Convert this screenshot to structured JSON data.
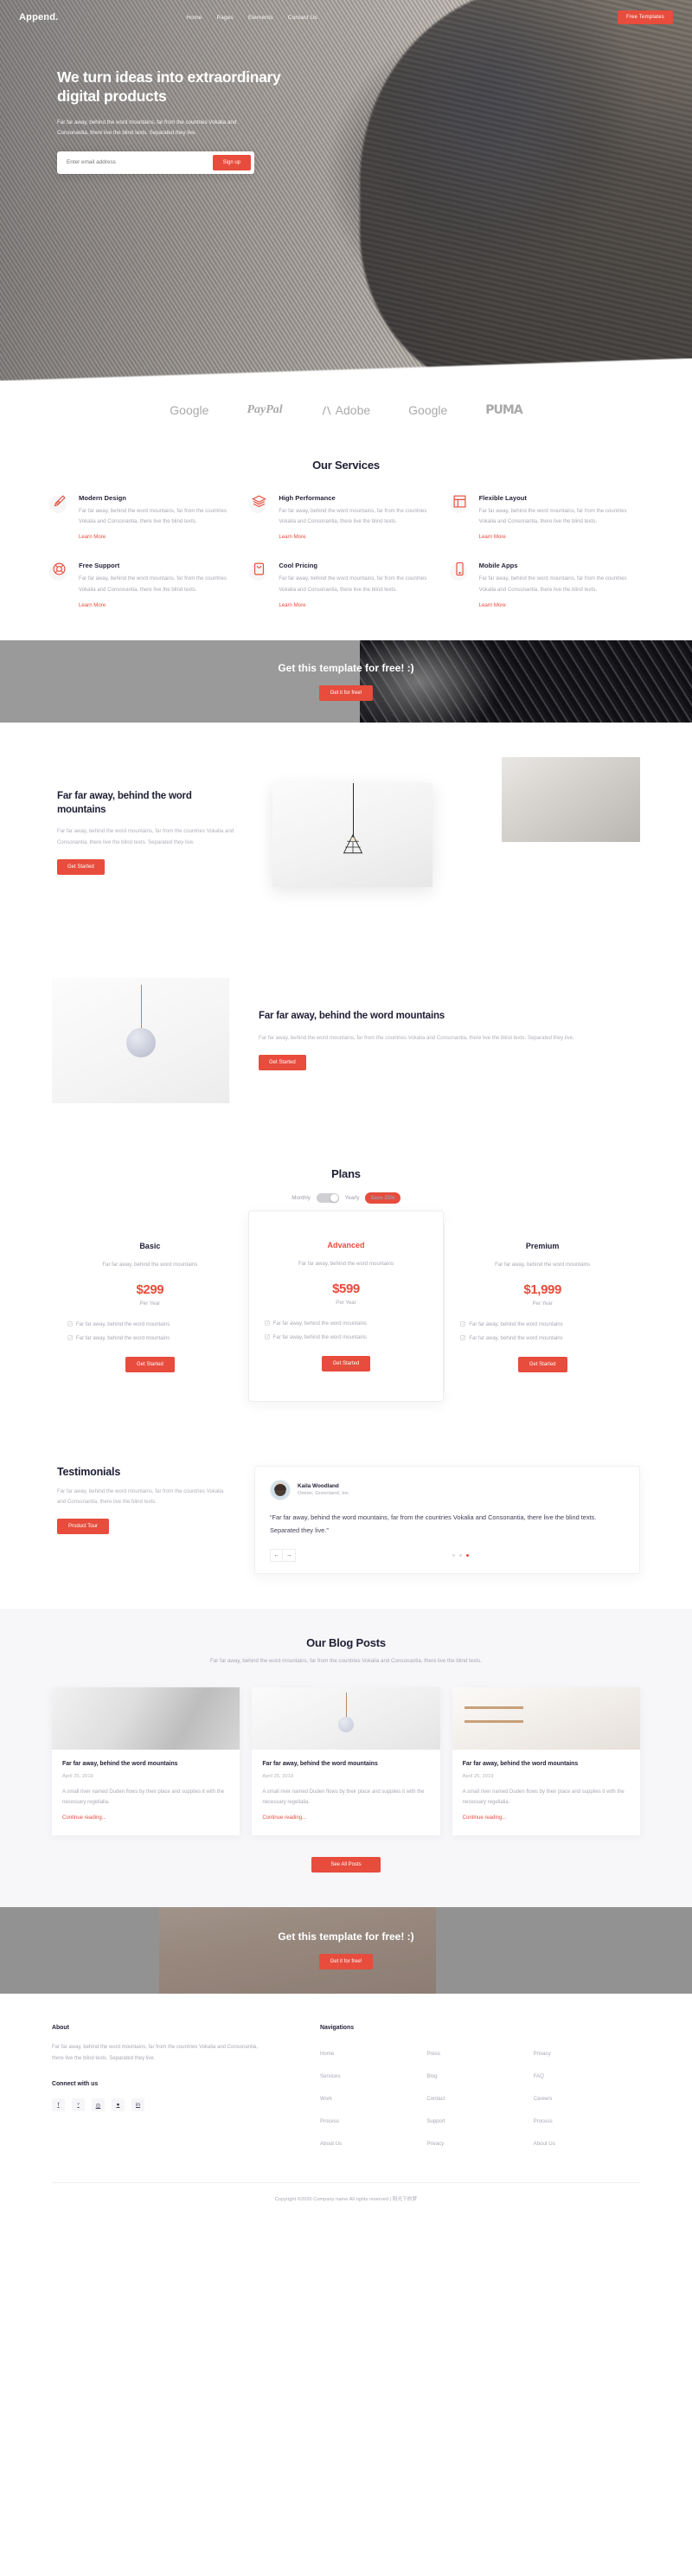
{
  "header": {
    "logo": "Append.",
    "nav": [
      {
        "label": "Home"
      },
      {
        "label": "Pages"
      },
      {
        "label": "Elements"
      },
      {
        "label": "Contact Us"
      }
    ],
    "cta_button": "Free Templates"
  },
  "hero": {
    "title": "We turn ideas into extraordinary digital products",
    "subtitle": "Far far away, behind the word mountains, far from the countries Vokalia and Consonantia, there live the blind texts. Separated they live.",
    "email_placeholder": "Enter email address",
    "email_value": "",
    "signup_button": "Sign up"
  },
  "brands": [
    {
      "name": "Google"
    },
    {
      "name": "PayPal"
    },
    {
      "name": "Adobe"
    },
    {
      "name": "Google"
    },
    {
      "name": "PUMA"
    }
  ],
  "services": {
    "title": "Our Services",
    "link_label": "Learn More",
    "items": [
      {
        "icon": "pen-tool-icon",
        "title": "Modern Design",
        "text": "Far far away, behind the word mountains, far from the countries Vokalia and Consonantia, there live the blind texts."
      },
      {
        "icon": "layers-icon",
        "title": "High Performance",
        "text": "Far far away, behind the word mountains, far from the countries Vokalia and Consonantia, there live the blind texts."
      },
      {
        "icon": "grid-layout-icon",
        "title": "Flexible Layout",
        "text": "Far far away, behind the word mountains, far from the countries Vokalia and Consonantia, there live the blind texts."
      },
      {
        "icon": "lifebuoy-icon",
        "title": "Free Support",
        "text": "Far far away, behind the word mountains, far from the countries Vokalia and Consonantia, there live the blind texts."
      },
      {
        "icon": "price-tag-icon",
        "title": "Cool Pricing",
        "text": "Far far away, behind the word mountains, far from the countries Vokalia and Consonantia, there live the blind texts."
      },
      {
        "icon": "mobile-phone-icon",
        "title": "Mobile Apps",
        "text": "Far far away, behind the word mountains, far from the countries Vokalia and Consonantia, there live the blind texts."
      }
    ]
  },
  "cta_banner": {
    "title": "Get this template for free! :)",
    "button": "Get it for free!"
  },
  "feature_one": {
    "title": "Far far away, behind the word mountains",
    "text": "Far far away, behind the word mountains, far from the countries Vokalia and Consonantia, there live the blind texts. Separated they live.",
    "button": "Get Started"
  },
  "feature_two": {
    "title": "Far far away, behind the word mountains",
    "text": "Far far away, behind the word mountains, far from the countries Vokalia and Consonantia, there live the blind texts. Separated they live.",
    "button": "Get Started"
  },
  "plans": {
    "title": "Plans",
    "toggle_monthly": "Monthly",
    "toggle_yearly": "Yearly",
    "save_badge": "Save 25%",
    "items": [
      {
        "name": "Basic",
        "desc": "Far far away, behind the word mountains",
        "price": "$299",
        "period": "Per Year",
        "features": [
          "Far far away, behind the word mountains",
          "Far far away, behind the word mountains"
        ],
        "button": "Get Started"
      },
      {
        "name": "Advanced",
        "desc": "Far far away, behind the word mountains",
        "price": "$599",
        "period": "Per Year",
        "features": [
          "Far far away, behind the word mountains",
          "Far far away, behind the word mountains"
        ],
        "button": "Get Started"
      },
      {
        "name": "Premium",
        "desc": "Far far away, behind the word mountains",
        "price": "$1,999",
        "period": "Per Year",
        "features": [
          "Far far away, behind the word mountains",
          "Far far away, behind the word mountains"
        ],
        "button": "Get Started"
      }
    ]
  },
  "testimonials": {
    "title": "Testimonials",
    "text": "Far far away, behind the word mountains, far from the countries Vokalia and Consonantia, there live the blind texts.",
    "button": "Product Tour",
    "author_name": "Kaila Woodland",
    "author_role": "Owner, Greenland, Inc.",
    "quote": "“Far far away, behind the word mountains, far from the countries Vokalia and Consonantia, there live the blind texts. Separated they live.”",
    "prev_arrow": "←",
    "next_arrow": "→",
    "dots_count": 3,
    "active_dot": 3
  },
  "blog": {
    "title": "Our Blog Posts",
    "subtitle": "Far far away, behind the word mountains, far from the countries Vokalia and Consonantia, there live the blind texts.",
    "read_more_label": "Continue reading...",
    "posts": [
      {
        "title": "Far far away, behind the word mountains",
        "date": "April 25, 2019",
        "excerpt": "A small river named Duden flows by their place and supplies it with the necessary regelialia."
      },
      {
        "title": "Far far away, behind the word mountains",
        "date": "April 25, 2019",
        "excerpt": "A small river named Duden flows by their place and supplies it with the necessary regelialia."
      },
      {
        "title": "Far far away, behind the word mountains",
        "date": "April 25, 2019",
        "excerpt": "A small river named Duden flows by their place and supplies it with the necessary regelialia."
      }
    ],
    "see_all_button": "See All Posts"
  },
  "cta_banner_two": {
    "title": "Get this template for free! :)",
    "button": "Get it for free!"
  },
  "footer": {
    "about_heading": "About",
    "about_text": "Far far away, behind the word mountains, far from the countries Vokalia and Consonantia, there live the blind texts. Separated they live.",
    "connect_heading": "Connect with us",
    "socials": [
      {
        "icon": "facebook-icon",
        "glyph": "f"
      },
      {
        "icon": "twitter-icon",
        "glyph": "ᵛ"
      },
      {
        "icon": "instagram-icon",
        "glyph": "◎"
      },
      {
        "icon": "dribbble-icon",
        "glyph": "●"
      },
      {
        "icon": "linkedin-icon",
        "glyph": "in"
      }
    ],
    "nav_heading": "Navigations",
    "nav_columns": [
      [
        "Home",
        "Services",
        "Work",
        "Process",
        "About Us"
      ],
      [
        "Press",
        "Blog",
        "Contact",
        "Support",
        "Privacy"
      ],
      [
        "Privacy",
        "FAQ",
        "Careers",
        "Process",
        "About Us"
      ]
    ],
    "copyright": "Copyright ©2020 Company name All rights reserved | 阳光下的梦"
  },
  "colors": {
    "accent": "#e74c3c",
    "dark": "#1f1f35",
    "muted": "#a9a9b4"
  }
}
